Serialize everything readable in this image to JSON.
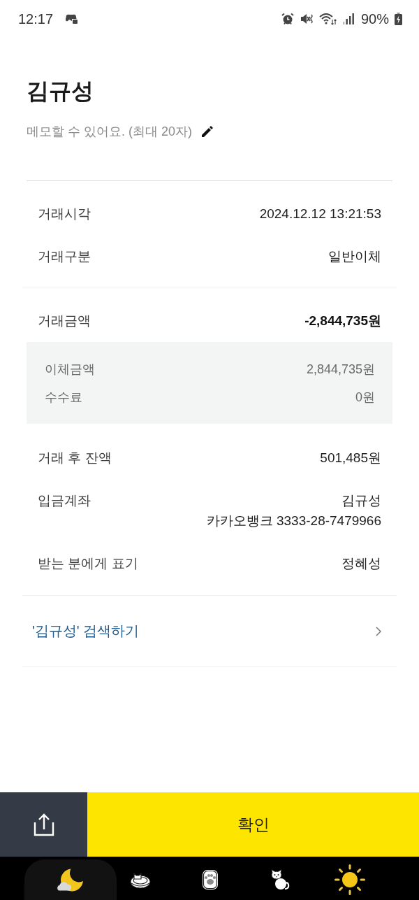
{
  "status_bar": {
    "time": "12:17",
    "battery": "90%"
  },
  "header": {
    "title": "김규성",
    "memo_prompt": "메모할 수 있어요. (최대 20자)"
  },
  "groups": [
    {
      "rows": [
        {
          "kind": "plain",
          "label": "거래시각",
          "value": "2024.12.12 13:21:53"
        },
        {
          "kind": "plain",
          "label": "거래구분",
          "value": "일반이체"
        }
      ]
    },
    {
      "rows": [
        {
          "kind": "total",
          "label": "거래금액",
          "value": "-2,844,735원"
        },
        {
          "kind": "breakdown",
          "items": [
            {
              "label": "이체금액",
              "value": "2,844,735원"
            },
            {
              "label": "수수료",
              "value": "0원"
            }
          ]
        },
        {
          "kind": "plain",
          "label": "거래 후 잔액",
          "value": "501,485원"
        },
        {
          "kind": "plain",
          "label": "입금계좌",
          "value": "김규성",
          "detail": "카카오뱅크 3333-28-7479966"
        },
        {
          "kind": "plain",
          "label": "받는 분에게 표기",
          "value": "정혜성"
        }
      ]
    }
  ],
  "search_link": "'김규성' 검색하기",
  "actions": {
    "confirm": "확인"
  },
  "nav_bar": [
    {
      "kind": "moon",
      "selected": true
    },
    {
      "kind": "cat_bed",
      "selected": false
    },
    {
      "kind": "paw",
      "selected": false
    },
    {
      "kind": "cat",
      "selected": false
    },
    {
      "kind": "sun",
      "selected": false
    }
  ]
}
